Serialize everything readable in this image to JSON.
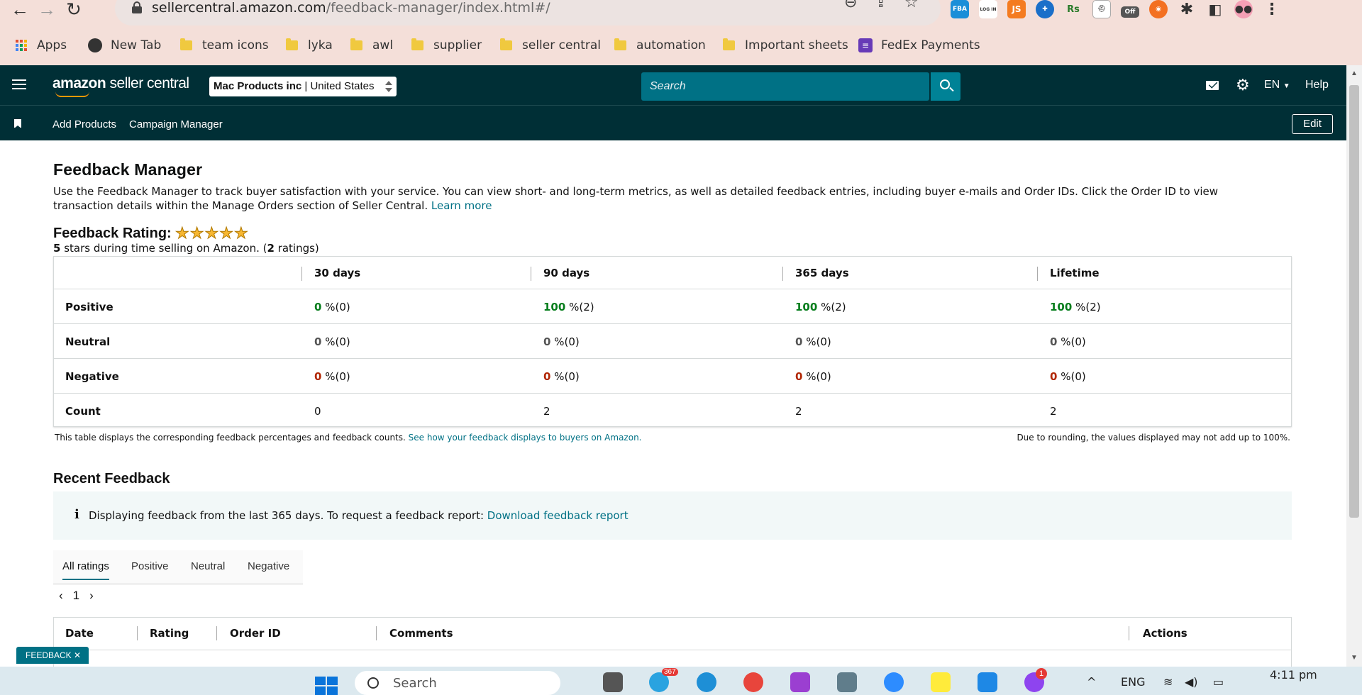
{
  "browser": {
    "url_host": "sellercentral.amazon.com",
    "url_path": "/feedback-manager/index.html#/",
    "extensions": [
      "FBA",
      "LOG IN",
      "JS",
      "Rs",
      "Off"
    ],
    "bookmarks": [
      "Apps",
      "New Tab",
      "team icons",
      "lyka",
      "awl",
      "supplier",
      "seller central",
      "automation",
      "Important sheets",
      "FedEx Payments"
    ]
  },
  "header": {
    "logo_bold": "amazon",
    "logo_rest": " seller central",
    "account_name": "Mac Products inc",
    "account_region": "United States",
    "search_placeholder": "Search",
    "lang": "EN",
    "help": "Help"
  },
  "subnav": {
    "links": [
      "Add Products",
      "Campaign Manager"
    ],
    "edit": "Edit"
  },
  "page": {
    "title": "Feedback Manager",
    "intro": "Use the Feedback Manager to track buyer satisfaction with your service. You can view short- and long-term metrics, as well as detailed feedback entries, including buyer e-mails and Order IDs. Click the Order ID to view transaction details within the Manage Orders section of Seller Central.",
    "learn_more": "Learn more",
    "rating_label": "Feedback Rating:",
    "stars": 5,
    "rating_sub_stars": "5",
    "rating_sub_a": " stars during time selling on Amazon. (",
    "rating_sub_count": "2",
    "rating_sub_b": " ratings)"
  },
  "feedback_table": {
    "columns": [
      "30 days",
      "90 days",
      "365 days",
      "Lifetime"
    ],
    "rows": [
      {
        "label": "Positive",
        "values": [
          "0",
          "100",
          "100",
          "100"
        ],
        "counts": [
          "%(0)",
          "%(2)",
          "%(2)",
          "%(2)"
        ]
      },
      {
        "label": "Neutral",
        "values": [
          "0",
          "0",
          "0",
          "0"
        ],
        "counts": [
          "%(0)",
          "%(0)",
          "%(0)",
          "%(0)"
        ]
      },
      {
        "label": "Negative",
        "values": [
          "0",
          "0",
          "0",
          "0"
        ],
        "counts": [
          "%(0)",
          "%(0)",
          "%(0)",
          "%(0)"
        ]
      },
      {
        "label": "Count",
        "values": [
          "0",
          "2",
          "2",
          "2"
        ]
      }
    ],
    "note": "This table displays the corresponding feedback percentages and feedback counts.",
    "note_link": "See how your feedback displays to buyers on Amazon.",
    "rounding_note": "Due to rounding, the values displayed may not add up to 100%."
  },
  "recent": {
    "title": "Recent Feedback",
    "info": "Displaying feedback from the last 365 days. To request a feedback report:",
    "download": "Download feedback report",
    "tabs": [
      "All ratings",
      "Positive",
      "Neutral",
      "Negative"
    ],
    "page": "1",
    "columns": [
      "Date",
      "Rating",
      "Order ID",
      "Comments",
      "Actions"
    ]
  },
  "feedback_tab": "FEEDBACK",
  "taskbar": {
    "search": "Search",
    "badge": "367",
    "messenger_badge": "1",
    "lang": "ENG",
    "time": "4:11 pm"
  },
  "colors": {
    "header": "#002f36",
    "accent": "#007185",
    "positive": "#067d1c",
    "negative": "#b12704"
  }
}
